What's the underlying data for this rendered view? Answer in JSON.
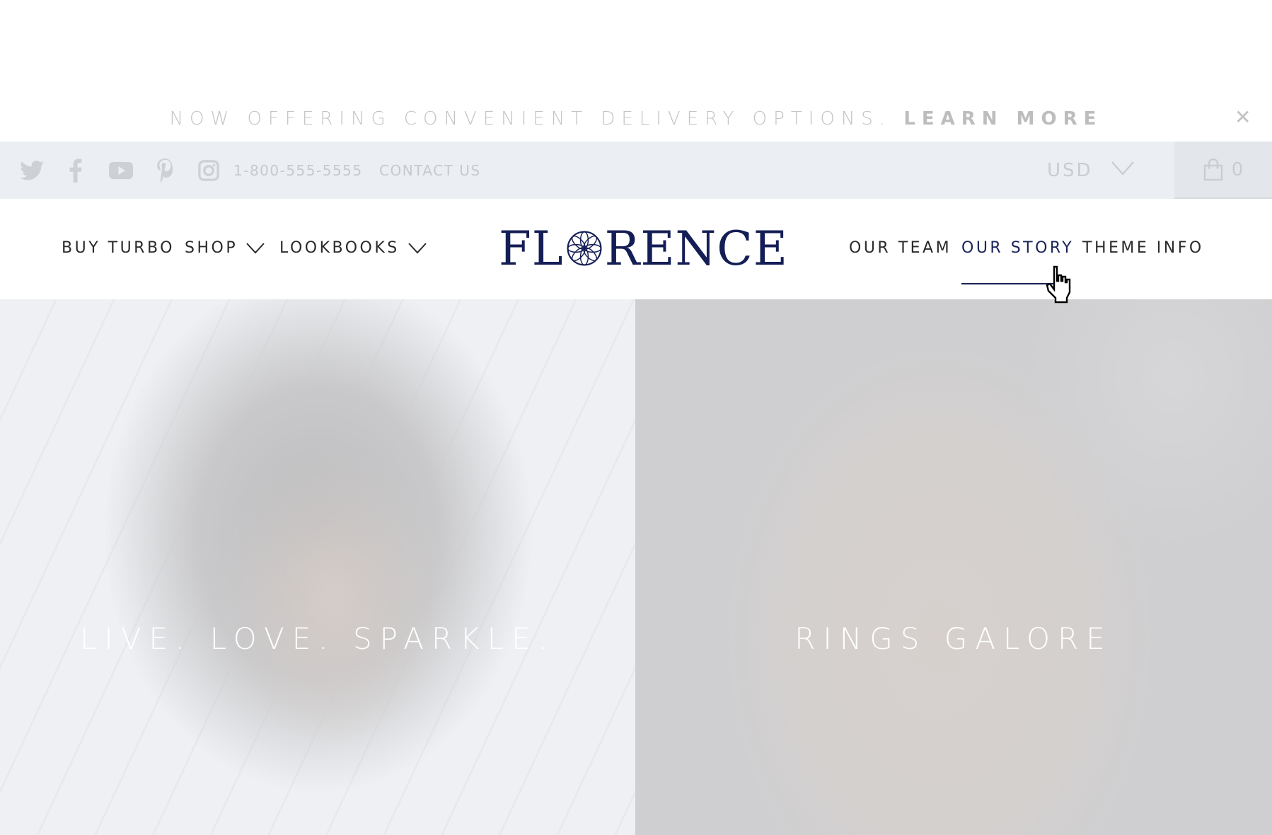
{
  "promo_bar": {
    "message": "NOW OFFERING CONVENIENT DELIVERY OPTIONS.",
    "link_label": "LEARN MORE",
    "close_icon": "close-icon"
  },
  "utility_bar": {
    "social_icons": [
      "twitter-icon",
      "facebook-icon",
      "youtube-icon",
      "pinterest-icon",
      "instagram-icon"
    ],
    "phone": "1-800-555-5555",
    "contact_label": "CONTACT US",
    "currency": {
      "selected": "USD",
      "icon": "chevron-down-icon"
    },
    "cart": {
      "icon": "shopping-bag-icon",
      "count": "0"
    }
  },
  "header": {
    "logo": {
      "text_left": "FL",
      "text_right": "RENCE",
      "mark_icon": "flower-mandala-icon"
    },
    "left_nav": [
      {
        "label": "BUY TURBO",
        "has_dropdown": false
      },
      {
        "label": "SHOP",
        "has_dropdown": true
      },
      {
        "label": "LOOKBOOKS",
        "has_dropdown": true
      }
    ],
    "right_nav": [
      {
        "label": "OUR TEAM",
        "active": false
      },
      {
        "label": "OUR STORY",
        "active": true
      },
      {
        "label": "THEME INFO",
        "active": false
      }
    ]
  },
  "hero": {
    "panels": [
      {
        "title": "LIVE. LOVE. SPARKLE.",
        "image": "woman-portrait-with-earring"
      },
      {
        "title": "RINGS GALORE",
        "image": "hand-with-rings-on-concrete"
      }
    ]
  },
  "colors": {
    "brand_navy": "#141e55",
    "active_link": "#1a2457",
    "utility_bg": "#ebeef2",
    "muted_text": "#c4c4c4"
  }
}
